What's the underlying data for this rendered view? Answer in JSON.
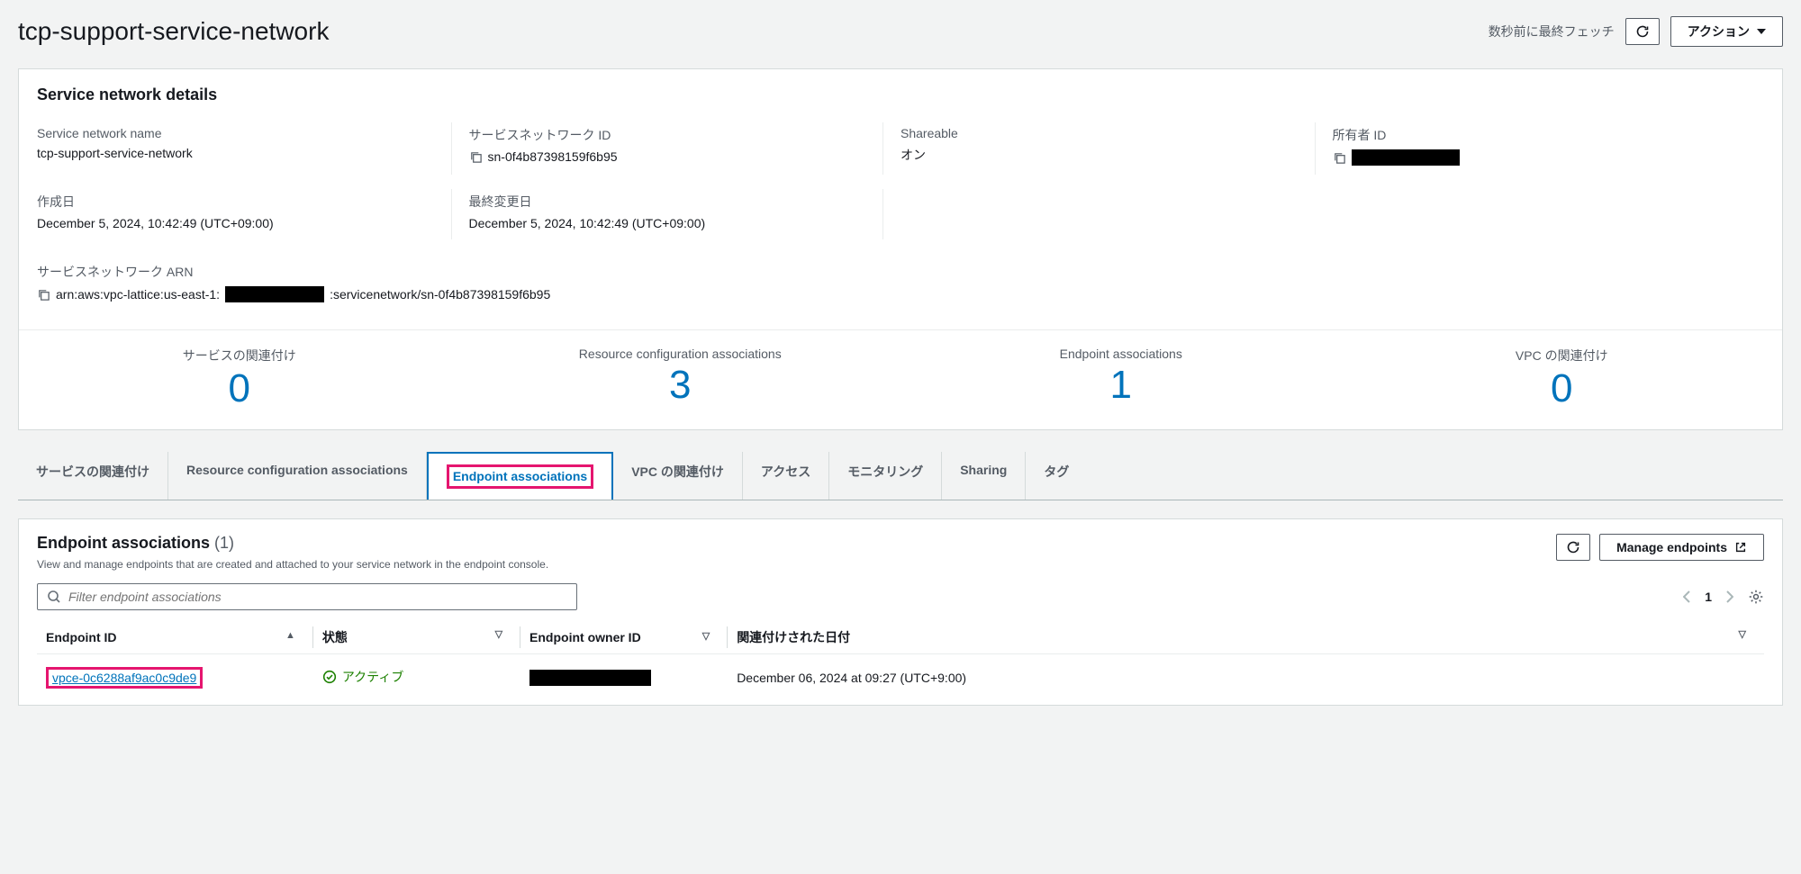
{
  "header": {
    "title": "tcp-support-service-network",
    "fetch_status": "数秒前に最終フェッチ",
    "actions_label": "アクション"
  },
  "details": {
    "panel_title": "Service network details",
    "name_label": "Service network name",
    "name_value": "tcp-support-service-network",
    "id_label": "サービスネットワーク ID",
    "id_value": "sn-0f4b87398159f6b95",
    "shareable_label": "Shareable",
    "shareable_value": "オン",
    "owner_label": "所有者 ID",
    "created_label": "作成日",
    "created_value": "December 5, 2024, 10:42:49 (UTC+09:00)",
    "modified_label": "最終変更日",
    "modified_value": "December 5, 2024, 10:42:49 (UTC+09:00)",
    "arn_label": "サービスネットワーク ARN",
    "arn_prefix": "arn:aws:vpc-lattice:us-east-1:",
    "arn_suffix": ":servicenetwork/sn-0f4b87398159f6b95"
  },
  "stats": [
    {
      "label": "サービスの関連付け",
      "value": "0"
    },
    {
      "label": "Resource configuration associations",
      "value": "3"
    },
    {
      "label": "Endpoint associations",
      "value": "1"
    },
    {
      "label": "VPC の関連付け",
      "value": "0"
    }
  ],
  "tabs": [
    "サービスの関連付け",
    "Resource configuration associations",
    "Endpoint associations",
    "VPC の関連付け",
    "アクセス",
    "モニタリング",
    "Sharing",
    "タグ"
  ],
  "endpoint": {
    "title": "Endpoint associations",
    "count": "(1)",
    "desc": "View and manage endpoints that are created and attached to your service network in the endpoint console.",
    "manage_label": "Manage endpoints",
    "filter_placeholder": "Filter endpoint associations",
    "page": "1",
    "columns": {
      "id": "Endpoint ID",
      "state": "状態",
      "owner": "Endpoint owner ID",
      "date": "関連付けされた日付"
    },
    "rows": [
      {
        "id": "vpce-0c6288af9ac0c9de9",
        "state": "アクティブ",
        "date": "December 06, 2024 at 09:27 (UTC+9:00)"
      }
    ]
  }
}
